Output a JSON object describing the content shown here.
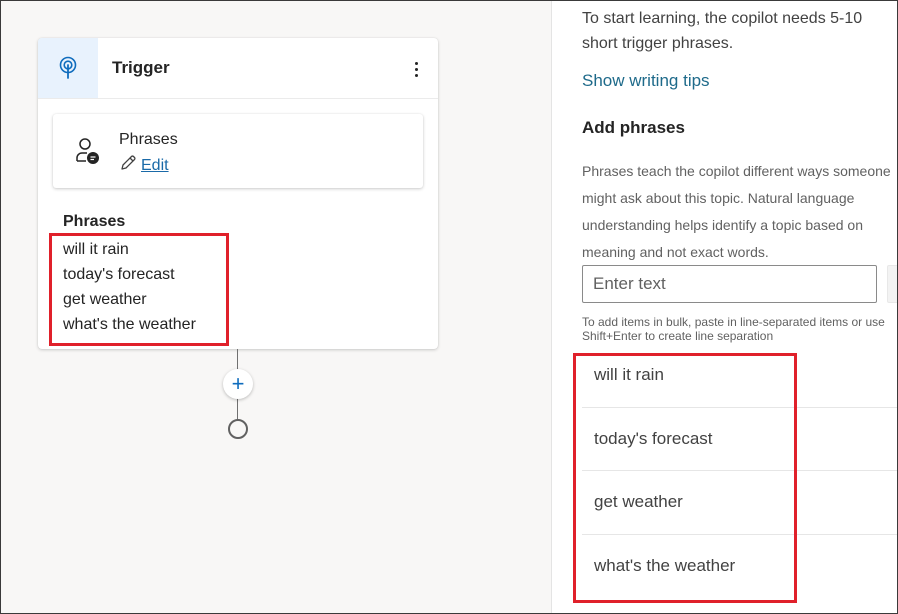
{
  "canvas": {
    "trigger_card": {
      "title": "Trigger",
      "more_icon": "more-vertical-icon",
      "header_icon": "trigger-icon",
      "inner_card": {
        "title": "Phrases",
        "icon": "person-chat-icon",
        "edit_label": "Edit",
        "edit_icon": "pencil-icon"
      },
      "phrases_heading": "Phrases",
      "phrases": [
        "will it rain",
        "today's forecast",
        "get weather",
        "what's the weather"
      ]
    },
    "add_node_icon": "plus-icon",
    "add_node_symbol": "+"
  },
  "panel": {
    "intro": "To start learning, the copilot needs 5-10 short trigger phrases.",
    "tips_link": "Show writing tips",
    "add_heading": "Add phrases",
    "description_lines": [
      "Phrases teach the copilot different ways someone",
      "might ask about this topic. Natural language",
      "understanding helps identify a topic based on",
      "meaning and not exact words."
    ],
    "input_placeholder": "Enter text",
    "bulk_hint_lines": [
      "To add items in bulk, paste in line-separated items or use",
      "Shift+Enter to create line separation"
    ],
    "phrases": [
      "will it rain",
      "today's forecast",
      "get weather",
      "what's the weather"
    ]
  },
  "colors": {
    "accent": "#0f6cbd",
    "link": "#1e6a8a",
    "highlight": "#e0202a",
    "trigger_icon_bg": "#e8f2fd"
  }
}
